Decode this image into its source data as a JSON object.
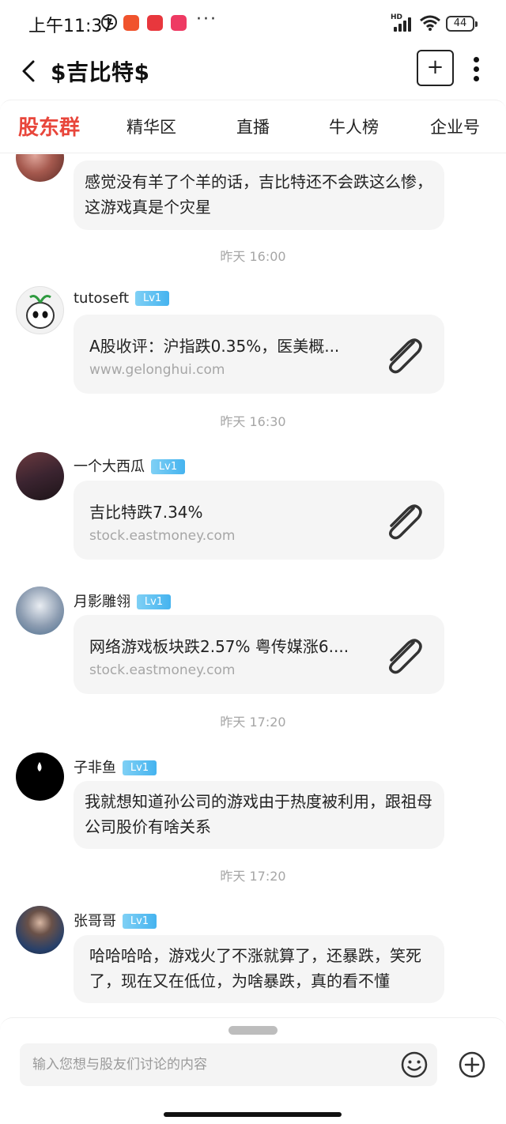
{
  "status_bar": {
    "time": "上午11:37",
    "more": "···",
    "hd": "HD",
    "battery": "44"
  },
  "header": {
    "title": "$吉比特$",
    "add_label": "+"
  },
  "tabs": [
    {
      "label": "股东群",
      "active": true
    },
    {
      "label": "精华区",
      "active": false
    },
    {
      "label": "直播",
      "active": false
    },
    {
      "label": "牛人榜",
      "active": false
    },
    {
      "label": "企业号",
      "active": false
    }
  ],
  "chat": {
    "top_message": "感觉没有羊了个羊的话，吉比特还不会跌这么惨，这游戏真是个灾星",
    "ts1": "昨天 16:00",
    "m1": {
      "username": "tutoseft",
      "level": "Lv1",
      "title": "A股收评：沪指跌0.35%，医美概...",
      "url": "www.gelonghui.com"
    },
    "ts2": "昨天 16:30",
    "m2": {
      "username": "一个大西瓜",
      "level": "Lv1",
      "title": "吉比特跌7.34%",
      "url": "stock.eastmoney.com"
    },
    "m3": {
      "username": "月影雕翎",
      "level": "Lv1",
      "title": "网络游戏板块跌2.57% 粤传媒涨6....",
      "url": "stock.eastmoney.com"
    },
    "ts3": "昨天 17:20",
    "m4": {
      "username": "子非鱼",
      "level": "Lv1",
      "text": "我就想知道孙公司的游戏由于热度被利用，跟祖母公司股价有啥关系"
    },
    "ts4": "昨天 17:20",
    "m5": {
      "username": "张哥哥",
      "level": "Lv1",
      "text": "哈哈哈哈，游戏火了不涨就算了，还暴跌，笑死了，现在又在低位，为啥暴跌，真的看不懂"
    }
  },
  "input": {
    "placeholder": "输入您想与股友们讨论的内容"
  },
  "colors": {
    "accent": "#e8463b",
    "badge": "#45b3ef",
    "bubble": "#f5f5f5",
    "muted": "#a6a6a6"
  },
  "icons": [
    "back-icon",
    "add-icon",
    "more-icon",
    "paperclip-icon",
    "emoji-icon",
    "plus-circle-icon"
  ]
}
